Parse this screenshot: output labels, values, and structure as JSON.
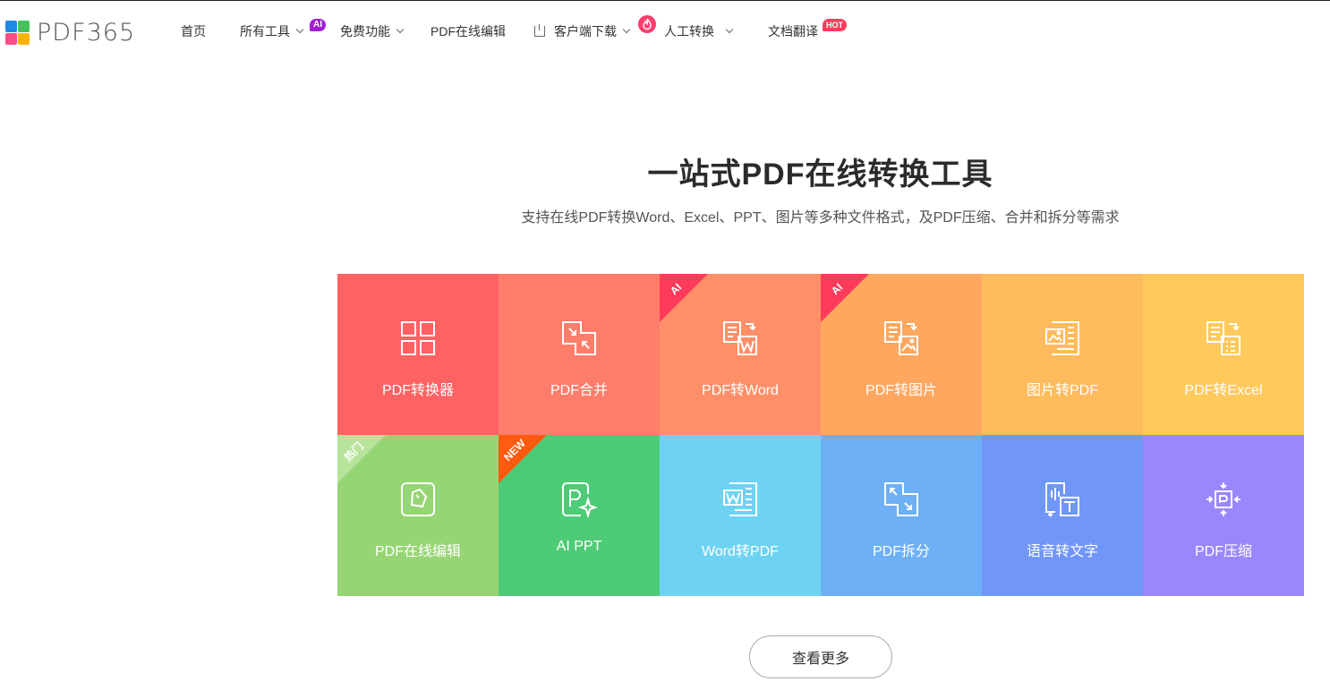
{
  "brand": {
    "name": "PDF365"
  },
  "nav": {
    "items": [
      {
        "label": "首页"
      },
      {
        "label": "所有工具"
      },
      {
        "label": "免费功能"
      },
      {
        "label": "PDF在线编辑"
      },
      {
        "label": "客户端下载"
      },
      {
        "label": "人工转换"
      },
      {
        "label": "文档翻译"
      }
    ],
    "badges": {
      "ai": "AI",
      "hot": "HOT"
    }
  },
  "hero": {
    "title": "一站式PDF在线转换工具",
    "subtitle": "支持在线PDF转换Word、Excel、PPT、图片等多种文件格式，及PDF压缩、合并和拆分等需求"
  },
  "tools": [
    {
      "label": "PDF转换器",
      "color": "#ff6263",
      "icon": "grid-icon",
      "tag": ""
    },
    {
      "label": "PDF合并",
      "color": "#ff7d6a",
      "icon": "merge-icon",
      "tag": ""
    },
    {
      "label": "PDF转Word",
      "color": "#ff8f68",
      "icon": "pdf-to-word-icon",
      "tag": "AI"
    },
    {
      "label": "PDF转图片",
      "color": "#ffa75f",
      "icon": "pdf-to-image-icon",
      "tag": "AI"
    },
    {
      "label": "图片转PDF",
      "color": "#ffbb5c",
      "icon": "image-to-pdf-icon",
      "tag": ""
    },
    {
      "label": "PDF转Excel",
      "color": "#ffc95c",
      "icon": "pdf-to-excel-icon",
      "tag": ""
    },
    {
      "label": "PDF在线编辑",
      "color": "#96d574",
      "icon": "edit-icon",
      "tag": "热门"
    },
    {
      "label": "AI PPT",
      "color": "#4ecb77",
      "icon": "ai-ppt-icon",
      "tag": "NEW"
    },
    {
      "label": "Word转PDF",
      "color": "#6ed3f3",
      "icon": "word-to-pdf-icon",
      "tag": ""
    },
    {
      "label": "PDF拆分",
      "color": "#6db0f6",
      "icon": "split-icon",
      "tag": ""
    },
    {
      "label": "语音转文字",
      "color": "#7096f8",
      "icon": "speech-to-text-icon",
      "tag": ""
    },
    {
      "label": "PDF压缩",
      "color": "#9b87fb",
      "icon": "compress-icon",
      "tag": ""
    }
  ],
  "tag_colors": {
    "AI": "#ff3b5c",
    "热门": "#b7e39a",
    "NEW": "#ff5a10"
  },
  "more_button": {
    "label": "查看更多"
  }
}
